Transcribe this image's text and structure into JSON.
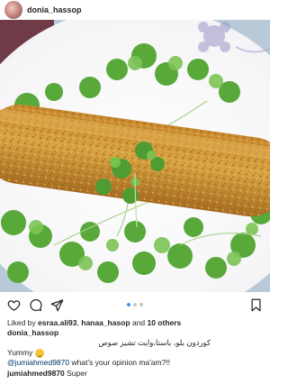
{
  "header": {
    "username": "donia_hassop"
  },
  "photo": {
    "description_icon": "food-photo"
  },
  "actions": {
    "icons": [
      "heart-icon",
      "comment-icon",
      "share-icon",
      "bookmark-icon"
    ],
    "carousel_dots": 3,
    "active_dot": 1
  },
  "likes": {
    "prefix": "Liked by ",
    "user1": "esraa.ali93",
    "sep": ", ",
    "user2": "hanaa_hasop",
    "and": " and ",
    "others": "10 others"
  },
  "caption": {
    "username": "donia_hassop",
    "arabic": "كوردون بلو، باستا،وايت تشيز صوص",
    "yummy": "Yummy",
    "emoji": "grinning-face-icon"
  },
  "comments": [
    {
      "mention": "@jumiahmed9870",
      "text": " what's your opinion ma'am?!!"
    },
    {
      "username": "jumiahmed9870",
      "text": " Super"
    }
  ],
  "colors": {
    "text": "#262626",
    "mention": "#003569",
    "active_dot": "#3897f0"
  }
}
